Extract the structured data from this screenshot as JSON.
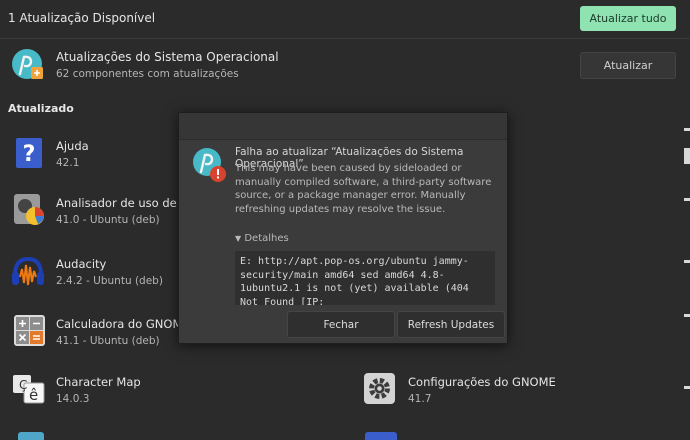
{
  "header": {
    "title": "1 Atualização Disponível",
    "update_all_label": "Atualizar tudo"
  },
  "os_update": {
    "icon": "pop-os-update-icon",
    "name": "Atualizações do Sistema Operacional",
    "subtitle": "62 componentes com atualizações",
    "button_label": "Atualizar"
  },
  "section_updated": "Atualizado",
  "apps": [
    {
      "name": "Ajuda",
      "subtitle": "42.1",
      "icon": "help-icon"
    },
    {
      "name": "Analisador de uso de dis",
      "subtitle": "41.0 - Ubuntu (deb)",
      "icon": "disk-usage-icon"
    },
    {
      "name": "Audacity",
      "subtitle": "2.4.2 - Ubuntu (deb)",
      "icon": "audacity-icon"
    },
    {
      "name": "Calculadora do GNOME",
      "subtitle": "41.1 - Ubuntu (deb)",
      "icon": "calculator-icon"
    },
    {
      "name": "Character Map",
      "subtitle": "14.0.3",
      "icon": "character-map-icon"
    },
    {
      "name": "Configurações do GNOME",
      "subtitle": "41.7",
      "icon": "gnome-settings-icon"
    }
  ],
  "dialog": {
    "title": "Falha ao atualizar “Atualizações do Sistema Operacional”",
    "body": "This may have been caused by sideloaded or manually compiled software, a third-party software source, or a package manager error. Manually refreshing updates may resolve the issue.",
    "details_label": "Detalhes",
    "details_text": "E: http://apt.pop-os.org/ubuntu jammy-security/main amd64 sed amd64 4.8-1ubuntu2.1 is not (yet) available (404  Not Found [IP:",
    "close_label": "Fechar",
    "refresh_label": "Refresh Updates"
  },
  "colors": {
    "background": "#2b2b2b",
    "accent_button": "#8ee3b1",
    "dialog_bg": "#3b3b3b",
    "error_badge": "#d8432f",
    "popos_teal": "#48b9c7"
  }
}
